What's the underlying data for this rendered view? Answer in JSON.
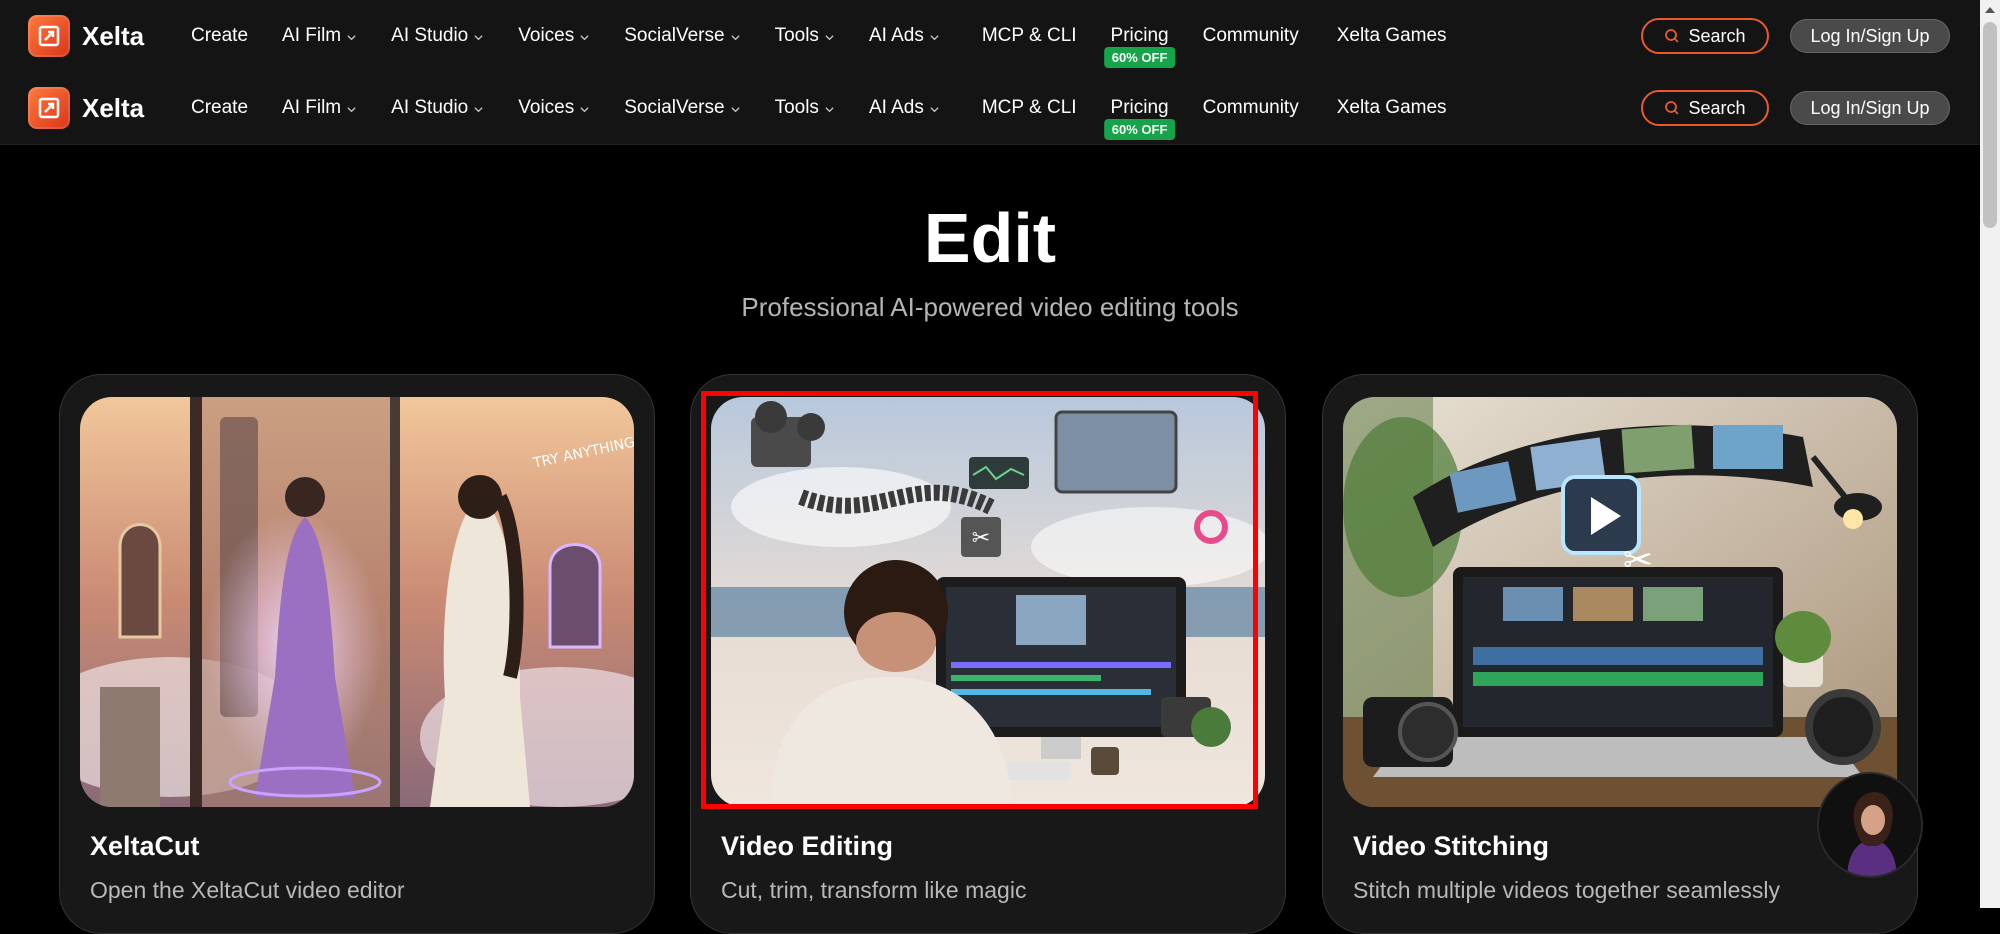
{
  "brand": {
    "name": "Xelta"
  },
  "nav": {
    "items": [
      {
        "label": "Create",
        "dropdown": false
      },
      {
        "label": "AI Film",
        "dropdown": true
      },
      {
        "label": "AI Studio",
        "dropdown": true
      },
      {
        "label": "Voices",
        "dropdown": true
      },
      {
        "label": "SocialVerse",
        "dropdown": true
      },
      {
        "label": "Tools",
        "dropdown": true
      },
      {
        "label": "AI Ads",
        "dropdown": true
      },
      {
        "label": "MCP & CLI",
        "dropdown": false
      },
      {
        "label": "Pricing",
        "dropdown": false,
        "badge": "60% OFF"
      },
      {
        "label": "Community",
        "dropdown": false
      },
      {
        "label": "Xelta Games",
        "dropdown": false
      }
    ],
    "search_label": "Search",
    "login_label": "Log In/Sign Up"
  },
  "hero": {
    "title": "Edit",
    "subtitle": "Professional AI-powered video editing tools"
  },
  "cards": [
    {
      "title": "XeltaCut",
      "description": "Open the XeltaCut video editor"
    },
    {
      "title": "Video Editing",
      "description": "Cut, trim, transform like magic"
    },
    {
      "title": "Video Stitching",
      "description": "Stitch multiple videos together seamlessly"
    }
  ],
  "colors": {
    "accent": "#e85a2b",
    "badge": "#16a34a",
    "highlight": "#ff0000",
    "background": "#000000",
    "nav_bg": "#141414"
  }
}
